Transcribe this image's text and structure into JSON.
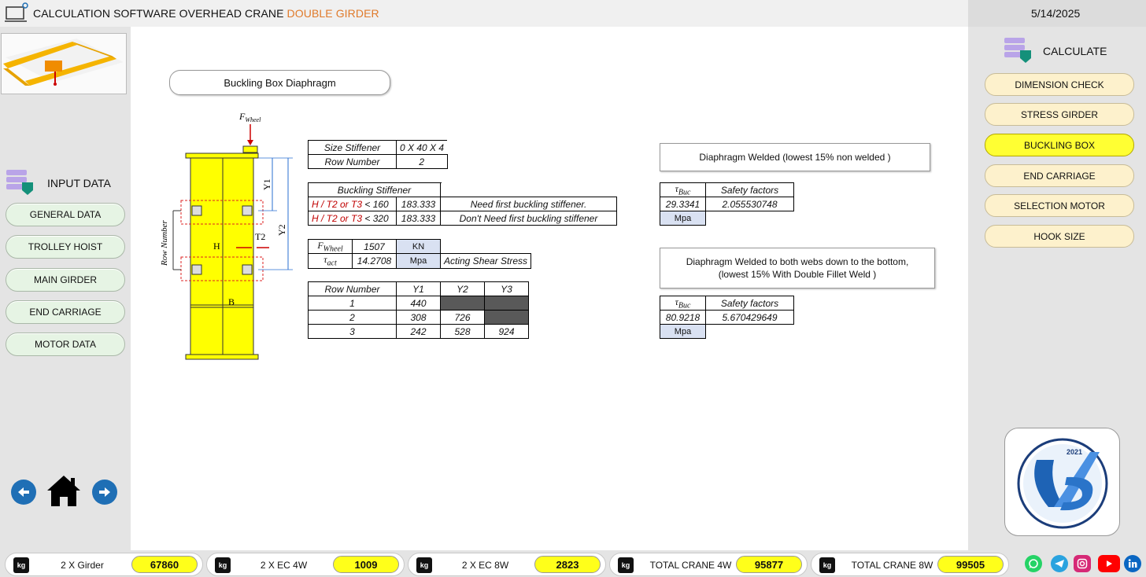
{
  "header": {
    "title_main": "CALCULATION SOFTWARE OVERHEAD CRANE ",
    "title_accent": "DOUBLE GIRDER",
    "date": "5/14/2025"
  },
  "left": {
    "section_label": "INPUT DATA",
    "nav": [
      "GENERAL DATA",
      "TROLLEY HOIST",
      "MAIN GIRDER",
      "END CARRIAGE",
      "MOTOR DATA"
    ]
  },
  "right": {
    "section_label": "CALCULATE",
    "buttons": [
      "DIMENSION CHECK",
      "STRESS GIRDER",
      "BUCKLING BOX",
      "END CARRIAGE",
      "SELECTION MOTOR",
      "HOOK SIZE"
    ],
    "active": "BUCKLING BOX",
    "logo_year": "2021"
  },
  "main": {
    "page_title": "Buckling Box Diaphragm",
    "diagram": {
      "f_label": "F",
      "f_sub": "Wheel",
      "y1": "Y1",
      "y2": "Y2",
      "h": "H",
      "t2": "T2",
      "b": "B",
      "row_number": "Row Number"
    },
    "stiffener": {
      "size_label": "Size Stiffener",
      "size_value": "0 X 40 X 4",
      "row_label": "Row Number",
      "row_value": "2"
    },
    "buckling": {
      "header": "Buckling Stiffener",
      "rows": [
        {
          "cond": "H / T2 or T3",
          "op": "< 160",
          "value": "183.333",
          "text": "Need first buckling stiffener."
        },
        {
          "cond": "H / T2 or T3",
          "op": "< 320",
          "value": "183.333",
          "text": "Don't Need first buckling stiffener"
        }
      ]
    },
    "forces": {
      "f_sym": "F",
      "f_sub": "Wheel",
      "f_value": "1507",
      "f_unit": "KN",
      "tau_sym": "τ",
      "tau_sub": "act",
      "tau_value": "14.2708",
      "tau_unit": "Mpa",
      "tau_text": "Acting Shear Stress"
    },
    "rows_table": {
      "headers": [
        "Row Number",
        "Y1",
        "Y2",
        "Y3"
      ],
      "rows": [
        [
          "1",
          "440",
          "",
          ""
        ],
        [
          "2",
          "308",
          "726",
          ""
        ],
        [
          "3",
          "242",
          "528",
          "924"
        ]
      ]
    },
    "welded1": {
      "caption": "Diaphragm Welded  (lowest 15% non welded )",
      "tau_sym": "τ",
      "tau_sub": "Buc",
      "sf_label": "Safety factors",
      "tau_value": "29.3341",
      "sf_value": "2.055530748",
      "unit": "Mpa"
    },
    "welded2": {
      "caption_line1": "Diaphragm Welded to both webs down to the bottom,",
      "caption_line2": "(lowest 15% With Double Fillet Weld )",
      "tau_sym": "τ",
      "tau_sub": "Buc",
      "sf_label": "Safety factors",
      "tau_value": "80.9218",
      "sf_value": "5.670429649",
      "unit": "Mpa"
    }
  },
  "footer": [
    {
      "label": "2 X Girder",
      "value": "67860"
    },
    {
      "label": "2 X EC 4W",
      "value": "1009"
    },
    {
      "label": "2 X EC 8W",
      "value": "2823"
    },
    {
      "label": "TOTAL CRANE 4W",
      "value": "95877"
    },
    {
      "label": "TOTAL CRANE 8W",
      "value": "99505"
    }
  ],
  "unit_badge": "kg",
  "social": [
    "whatsapp-icon",
    "telegram-icon",
    "instagram-icon",
    "youtube-icon",
    "linkedin-icon"
  ],
  "colors": {
    "accent": "#e07a2a",
    "active_button": "#ffff33",
    "button": "#fdf1cc",
    "nav_button": "#e6f4e4",
    "kpi_value": "#ffff1a",
    "girder": "#ffff00"
  }
}
